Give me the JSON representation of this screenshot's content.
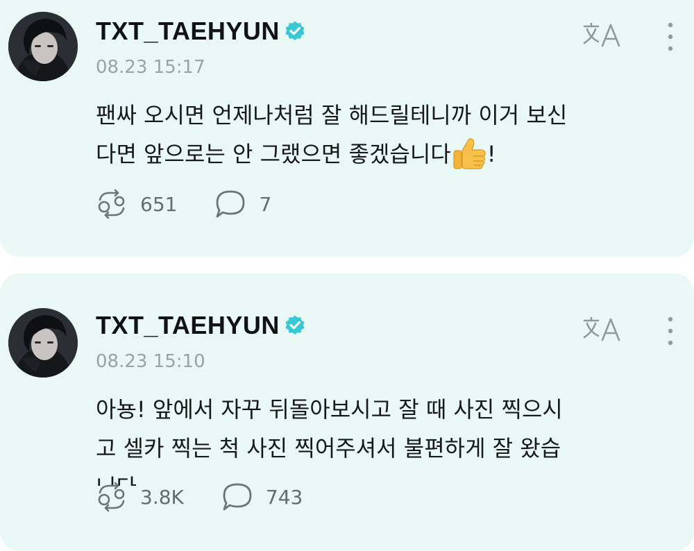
{
  "posts": [
    {
      "username": "TXT_TAEHYUN",
      "timestamp": "08.23 15:17",
      "lines": [
        "팬싸 오시면 언제나처럼 잘 해드릴테니까 이거 보신",
        "다면 앞으로는 안 그랬으면 좋겠습니다"
      ],
      "trailing": "!",
      "reposts": "651",
      "comments": "7"
    },
    {
      "username": "TXT_TAEHYUN",
      "timestamp": "08.23 15:10",
      "lines": [
        "아뇽! 앞에서 자꾸 뒤돌아보시고 잘 때 사진 찍으시",
        "고 셀카 찍는 척 사진 찍어주셔서 불편하게 잘 왔습",
        "니다"
      ],
      "reposts": "3.8K",
      "comments": "743"
    }
  ],
  "icons": {
    "verified": "verified-badge-icon",
    "translate": "translate-icon",
    "more": "more-vertical-icon",
    "repost": "repost-icon",
    "comment": "comment-bubble-icon",
    "emoji": "thumbs-up-icon"
  },
  "colors": {
    "card_background": "#e9f8f5",
    "verified_badge": "#38c8d4",
    "meta_text": "#9aa3a3"
  }
}
